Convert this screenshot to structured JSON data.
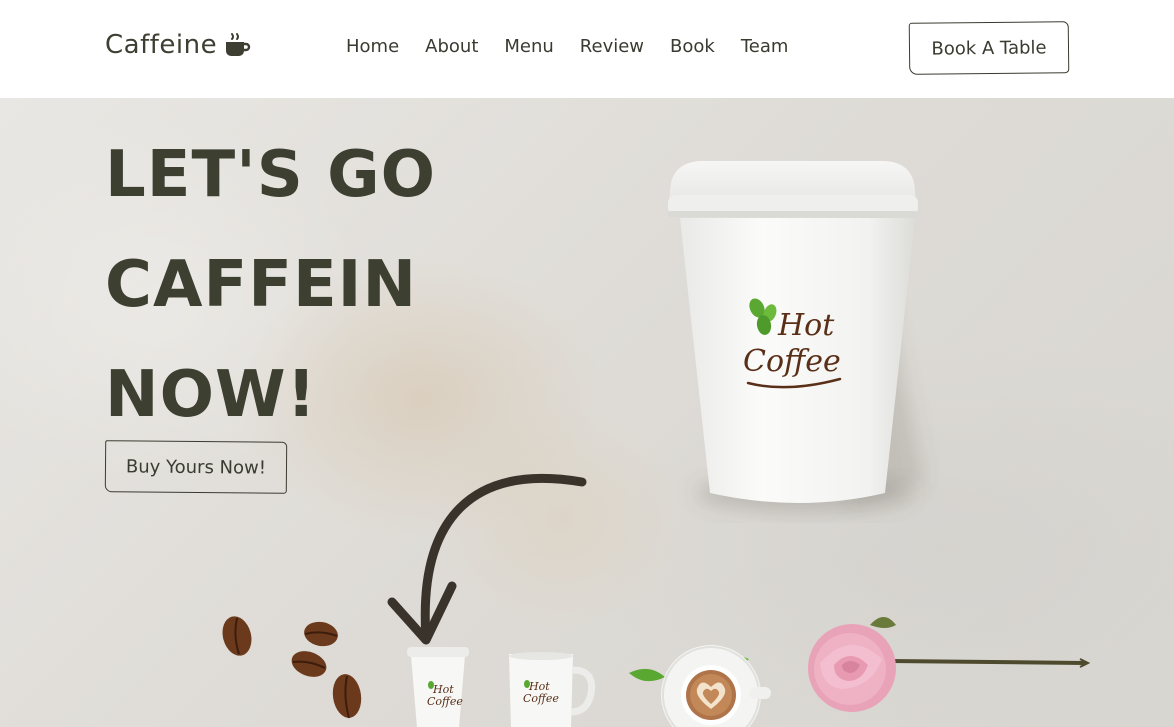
{
  "navbar": {
    "brand": "Caffeine",
    "brand_icon": "coffee-cup-icon",
    "links": [
      "Home",
      "About",
      "Menu",
      "Review",
      "Book",
      "Team"
    ],
    "cta": "Book A Table"
  },
  "hero": {
    "title_lines": [
      "LET'S GO",
      "CAFFEIN",
      "NOW!"
    ],
    "button": "Buy Yours Now!",
    "cup_logo": {
      "line1": "Hot",
      "line2": "Coffee"
    }
  },
  "colors": {
    "text": "#3d3f30",
    "nav_bg": "#ffffff",
    "hero_bg": "#e7e4df",
    "logo_brown": "#5a2f18",
    "logo_green": "#5aa832"
  }
}
